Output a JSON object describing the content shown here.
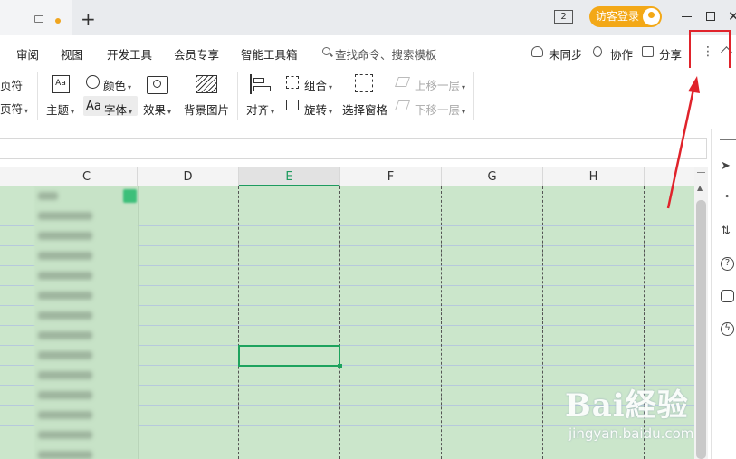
{
  "titlebar": {
    "plus_label": "+",
    "window_badge": "2",
    "login_label": "访客登录",
    "close_glyph": "✕"
  },
  "menu": {
    "items": [
      "审阅",
      "视图",
      "开发工具",
      "会员专享",
      "智能工具箱"
    ],
    "search_placeholder": "查找命令、搜索模板",
    "sync_label": "未同步",
    "collab_label": "协作",
    "share_label": "分享",
    "more_glyph": "⋮"
  },
  "ribbon": {
    "header_footer_a": "页符",
    "header_footer_b": "页符",
    "theme_label": "主题",
    "color_label": "颜色",
    "font_prefix": "Aa",
    "font_label": "字体",
    "effect_label": "效果",
    "bg_image_label": "背景图片",
    "align_label": "对齐",
    "group_label": "组合",
    "rotate_label": "旋转",
    "selection_pane_label": "选择窗格",
    "move_up_label": "上移一层",
    "move_down_label": "下移一层"
  },
  "grid": {
    "columns": [
      "C",
      "D",
      "E",
      "F",
      "G",
      "H"
    ],
    "selected_column": "E"
  },
  "annotation": {
    "highlight_color": "#e0232b"
  },
  "watermark": {
    "brand": "Bai経验",
    "url": "jingyan.baidu.com"
  }
}
